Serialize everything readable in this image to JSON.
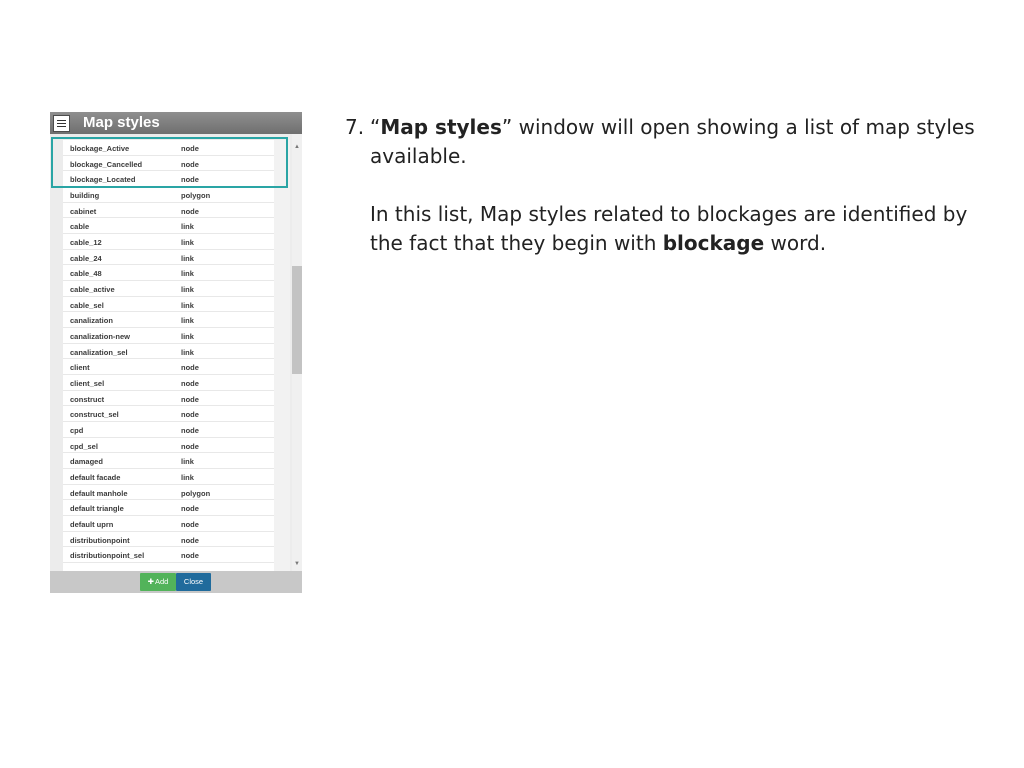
{
  "window": {
    "title": "Map styles",
    "styles": [
      {
        "name": "blockage_Active",
        "type": "node"
      },
      {
        "name": "blockage_Cancelled",
        "type": "node"
      },
      {
        "name": "blockage_Located",
        "type": "node"
      },
      {
        "name": "building",
        "type": "polygon"
      },
      {
        "name": "cabinet",
        "type": "node"
      },
      {
        "name": "cable",
        "type": "link"
      },
      {
        "name": "cable_12",
        "type": "link"
      },
      {
        "name": "cable_24",
        "type": "link"
      },
      {
        "name": "cable_48",
        "type": "link"
      },
      {
        "name": "cable_active",
        "type": "link"
      },
      {
        "name": "cable_sel",
        "type": "link"
      },
      {
        "name": "canalization",
        "type": "link"
      },
      {
        "name": "canalization-new",
        "type": "link"
      },
      {
        "name": "canalization_sel",
        "type": "link"
      },
      {
        "name": "client",
        "type": "node"
      },
      {
        "name": "client_sel",
        "type": "node"
      },
      {
        "name": "construct",
        "type": "node"
      },
      {
        "name": "construct_sel",
        "type": "node"
      },
      {
        "name": "cpd",
        "type": "node"
      },
      {
        "name": "cpd_sel",
        "type": "node"
      },
      {
        "name": "damaged",
        "type": "link"
      },
      {
        "name": "default facade",
        "type": "link"
      },
      {
        "name": "default manhole",
        "type": "polygon"
      },
      {
        "name": "default triangle",
        "type": "node"
      },
      {
        "name": "default uprn",
        "type": "node"
      },
      {
        "name": "distributionpoint",
        "type": "node"
      },
      {
        "name": "distributionpoint_sel",
        "type": "node"
      }
    ],
    "footer": {
      "add_label": "Add",
      "close_label": "Close"
    },
    "colors": {
      "highlight": "#2aa5a5",
      "add_button": "#52b35a",
      "close_button": "#206b9c"
    }
  },
  "instructions": {
    "step_number": "7.",
    "quote_open": "“",
    "window_name": "Map styles",
    "step_text": "” window will open showing a list of map styles available.",
    "para_text": "In this list, Map styles related to blockages are identified by the fact that they begin with ",
    "para_bold": "blockage",
    "para_end": " word."
  }
}
